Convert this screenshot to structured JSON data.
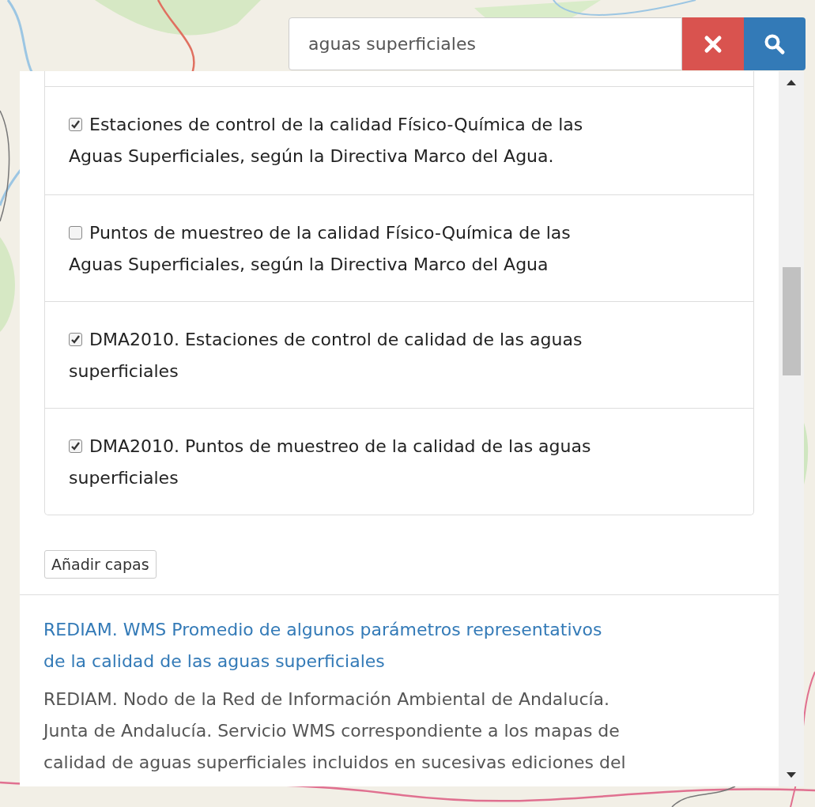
{
  "search": {
    "value": "aguas superficiales"
  },
  "layers": [
    {
      "label": "Estaciones de control de la calidad Físico-Química de las Aguas Superficiales, según la Directiva Marco del Agua.",
      "checked": true
    },
    {
      "label": "Puntos de muestreo de la calidad Físico-Química de las Aguas Superficiales, según la Directiva Marco del Agua",
      "checked": false
    },
    {
      "label": "DMA2010. Estaciones de control de calidad de las aguas superficiales",
      "checked": true
    },
    {
      "label": "DMA2010. Puntos de muestreo de la calidad de las aguas superficiales",
      "checked": true
    }
  ],
  "add_button": "Añadir capas",
  "result": {
    "title": "REDIAM. WMS Promedio de algunos parámetros representativos de la calidad de las aguas superficiales",
    "description": "REDIAM. Nodo de la Red de Información Ambiental de Andalucía. Junta de Andalucía. Servicio WMS correspondiente a los mapas de calidad de aguas superficiales incluidos en sucesivas ediciones del"
  }
}
